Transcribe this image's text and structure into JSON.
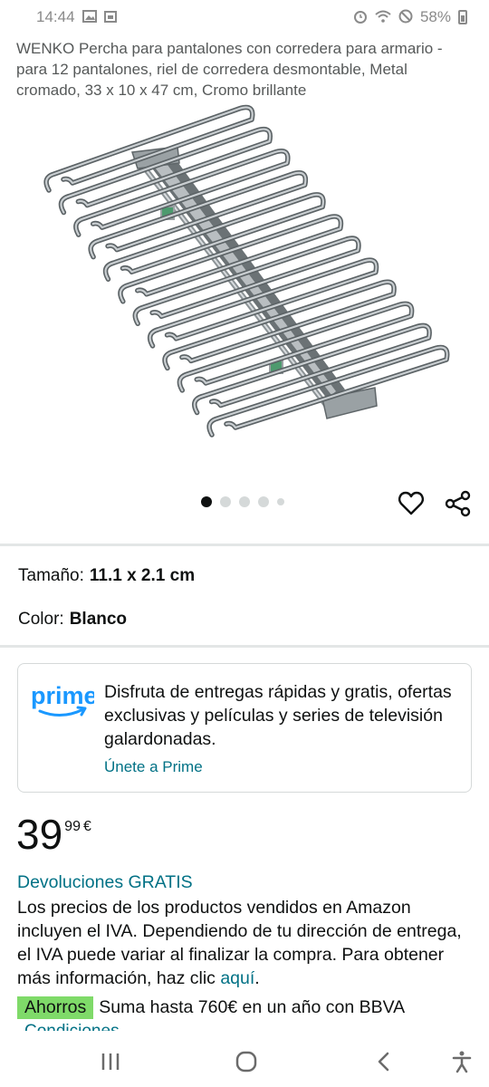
{
  "status_bar": {
    "time": "14:44",
    "battery": "58%",
    "icons": [
      "gallery-icon",
      "calendar-icon",
      "alarm-icon",
      "wifi-icon",
      "do-not-disturb-icon",
      "battery-icon"
    ]
  },
  "product": {
    "title": "WENKO Percha para pantalones con corredera para armario - para 12 pantalones, riel de corredera desmontable, Metal cromado, 33 x 10 x 47 cm, Cromo brillante",
    "image_count": 5,
    "active_image": 1
  },
  "variations": {
    "size_label": "Tamaño:",
    "size_value": "11.1 x 2.1 cm",
    "color_label": "Color:",
    "color_value": "Blanco"
  },
  "prime": {
    "logo_text": "prime",
    "description": "Disfruta de entregas rápidas y gratis, ofertas exclusivas y películas y series de televisión galardonadas.",
    "link": "Únete a Prime",
    "brand_color": "#1a98ff"
  },
  "price": {
    "whole": "39",
    "fraction": "99",
    "currency": "€"
  },
  "returns": {
    "link": "Devoluciones GRATIS",
    "tax_text": "Los precios de los productos vendidos en Amazon incluyen el IVA. Dependiendo de tu dirección de entrega, el IVA puede variar al finalizar la compra. Para obtener más información, haz clic ",
    "tax_link": "aquí",
    "tax_end": "."
  },
  "savings": {
    "badge": "Ahorros",
    "text": "Suma hasta 760€ en un año con BBVA",
    "conditions": "Condiciones"
  },
  "colors": {
    "link": "#007185",
    "savings_badge": "#7fda69",
    "text": "#0f1111"
  },
  "nav": {
    "icons": [
      "recent-apps-icon",
      "home-icon",
      "back-icon",
      "accessibility-icon"
    ]
  }
}
